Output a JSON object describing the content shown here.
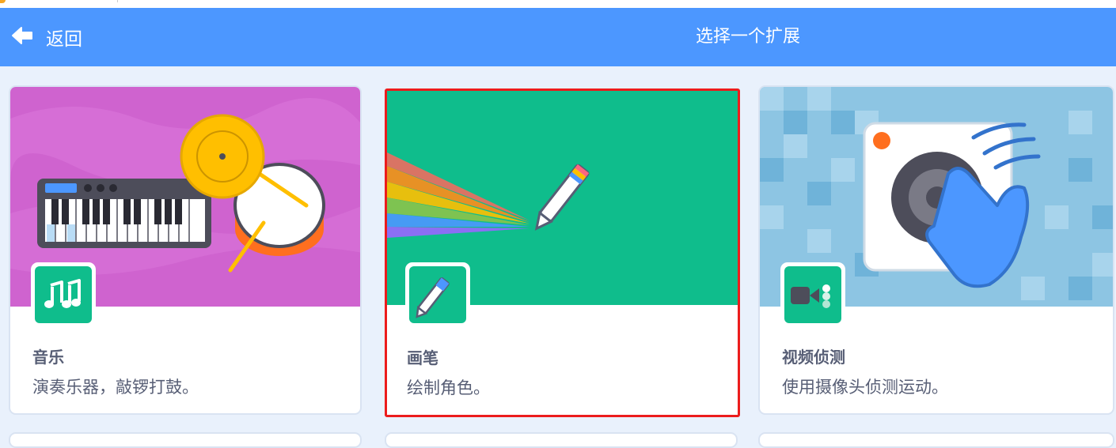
{
  "header": {
    "back_label": "返回",
    "title": "选择一个扩展"
  },
  "extensions": [
    {
      "title": "音乐",
      "description": "演奏乐器，敲锣打鼓。",
      "selected": false,
      "icon": "music-notes-icon",
      "banner_color": "#cf63cf"
    },
    {
      "title": "画笔",
      "description": "绘制角色。",
      "selected": true,
      "icon": "pen-icon",
      "banner_color": "#0fbd8c"
    },
    {
      "title": "视频侦测",
      "description": "使用摄像头侦测运动。",
      "selected": false,
      "icon": "video-camera-icon",
      "banner_color": "#8dc5e3"
    }
  ],
  "colors": {
    "header": "#4c97ff",
    "accent_green": "#0fbd8c",
    "selection": "#ec1c1c",
    "text": "#575e75"
  }
}
